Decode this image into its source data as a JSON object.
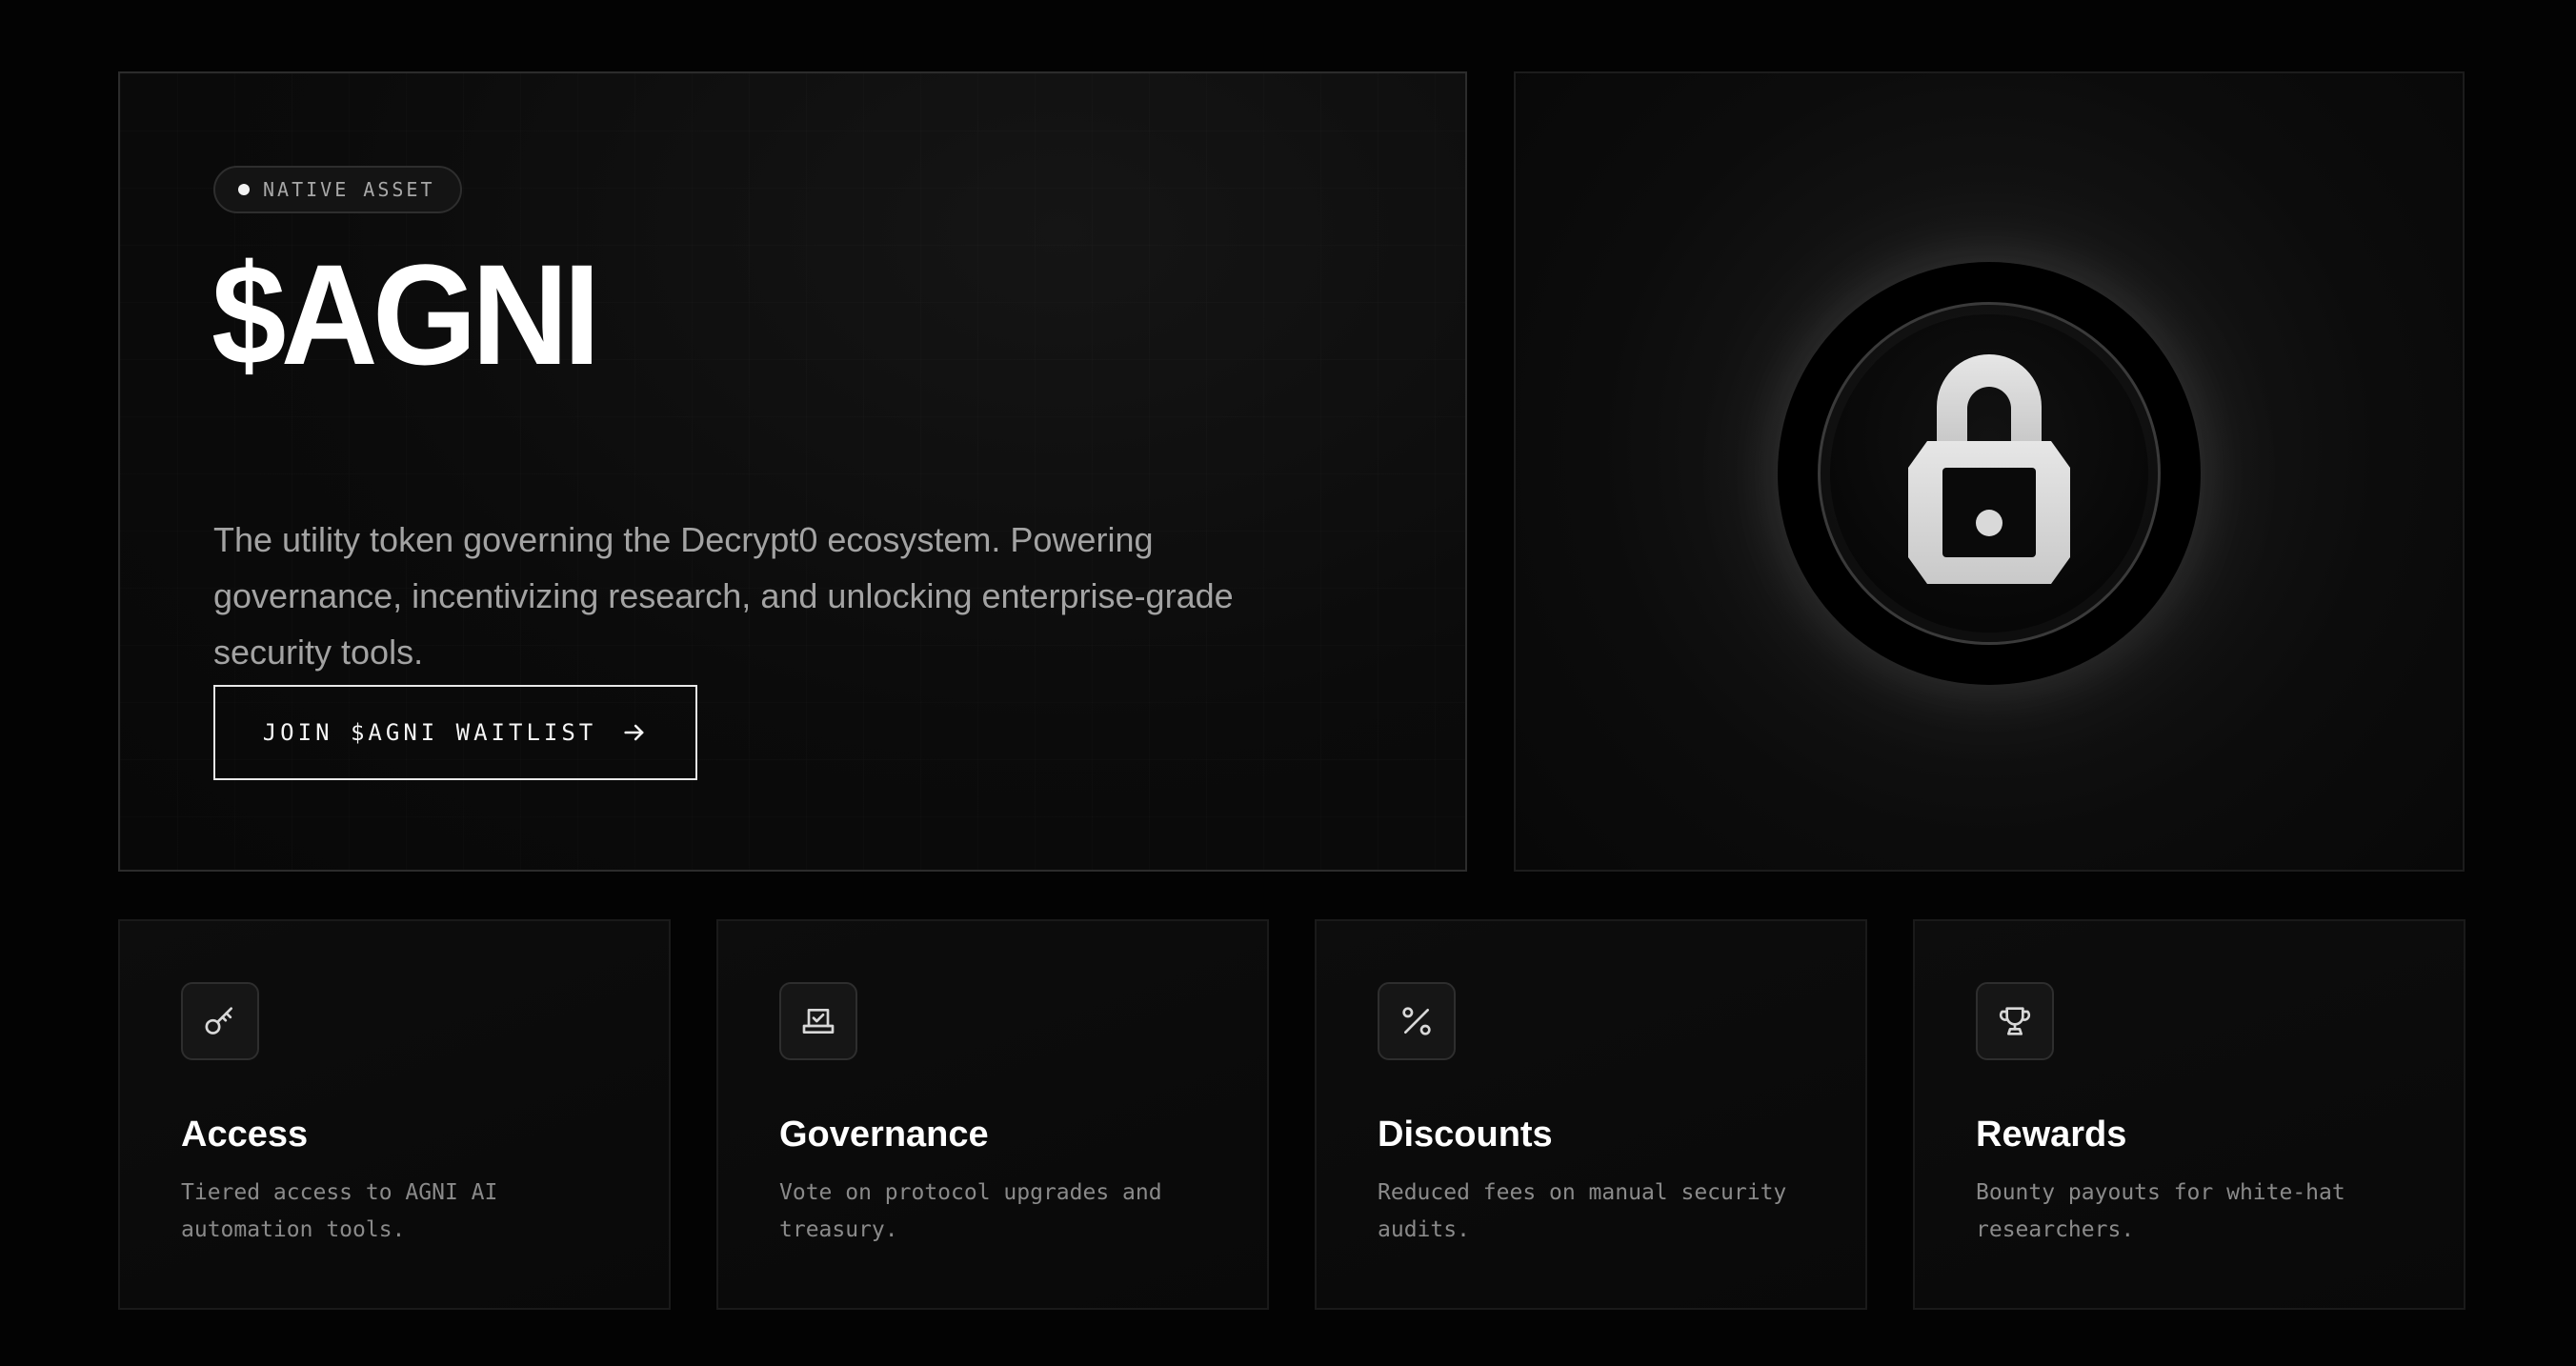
{
  "hero": {
    "badge": "NATIVE ASSET",
    "title": "$AGNI",
    "description": "The utility token governing the Decrypt0 ecosystem. Powering governance, incentivizing research, and unlocking enterprise-grade security tools.",
    "cta_label": "JOIN $AGNI WAITLIST",
    "cta_icon": "arrow-right-icon"
  },
  "visual": {
    "icon": "lock-icon"
  },
  "features": [
    {
      "icon": "key-icon",
      "title": "Access",
      "description": "Tiered access to AGNI AI automation tools."
    },
    {
      "icon": "ballot-box-icon",
      "title": "Governance",
      "description": "Vote on protocol upgrades and treasury."
    },
    {
      "icon": "percent-icon",
      "title": "Discounts",
      "description": "Reduced fees on manual security audits."
    },
    {
      "icon": "trophy-icon",
      "title": "Rewards",
      "description": "Bounty payouts for white-hat researchers."
    }
  ],
  "colors": {
    "background": "#030303",
    "card": "#0b0b0b",
    "border": "#2c2c2c",
    "text_primary": "#ffffff",
    "text_secondary": "#a3a3a3",
    "text_muted": "#8a8a8a"
  }
}
